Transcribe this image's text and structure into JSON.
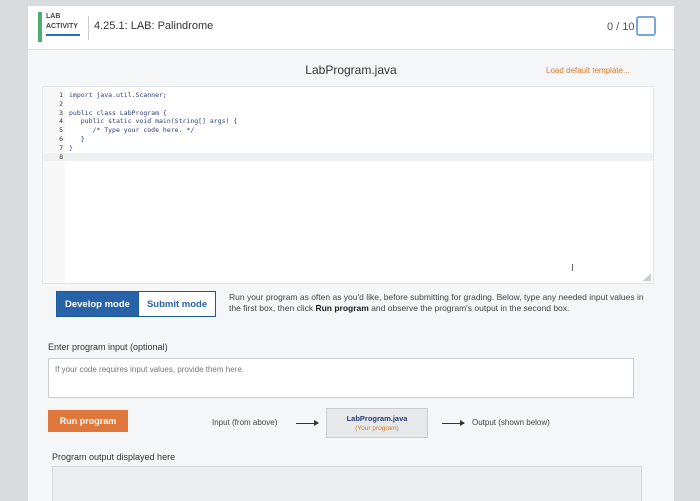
{
  "header": {
    "badge_line1": "LAB",
    "badge_line2": "ACTIVITY",
    "title": "4.25.1: LAB: Palindrome",
    "score": "0 / 10"
  },
  "file": {
    "name": "LabProgram.java",
    "load_default": "Load default template..."
  },
  "editor": {
    "lines": [
      {
        "n": "1",
        "code": "import java.util.Scanner;"
      },
      {
        "n": "2",
        "code": ""
      },
      {
        "n": "3",
        "code": "public class LabProgram {"
      },
      {
        "n": "4",
        "code": "   public static void main(String[] args) {"
      },
      {
        "n": "5",
        "code": "      /* Type your code here. */"
      },
      {
        "n": "6",
        "code": "   }"
      },
      {
        "n": "7",
        "code": "}"
      },
      {
        "n": "8",
        "code": ""
      }
    ]
  },
  "modes": {
    "develop_label": "Develop mode",
    "submit_label": "Submit mode",
    "description_pre": "Run your program as often as you'd like, before submitting for grading. Below, type any needed input values in the first box, then click ",
    "description_bold": "Run program",
    "description_post": " and observe the program's output in the second box."
  },
  "input": {
    "label": "Enter program input (optional)",
    "placeholder": "If your code requires input values, provide them here."
  },
  "run": {
    "button_label": "Run program",
    "flow_input": "Input (from above)",
    "flow_program": "LabProgram.java",
    "flow_program_sub": "(Your program)",
    "flow_output": "Output (shown below)"
  },
  "output": {
    "label": "Program output displayed here"
  },
  "colors": {
    "accent_blue": "#2862a8",
    "run_orange": "#e0773a",
    "link_orange": "#d9772b",
    "badge_green": "#4caf6f"
  }
}
